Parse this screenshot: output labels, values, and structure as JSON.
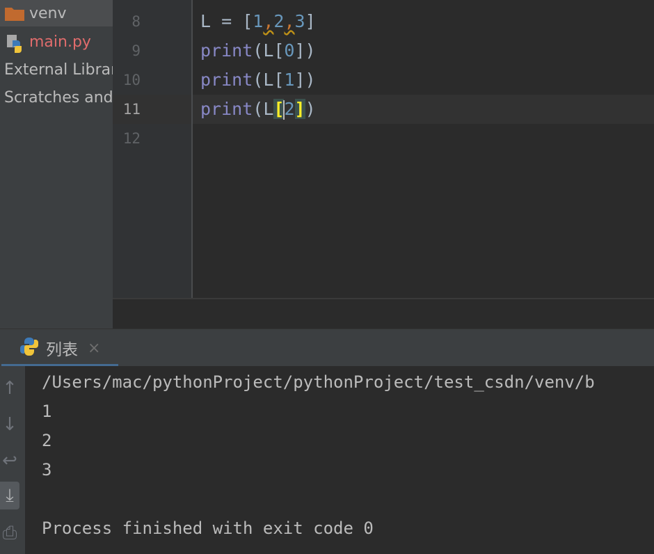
{
  "project_tree": {
    "items": [
      {
        "label": "venv",
        "icon": "folder-icon"
      },
      {
        "label": "main.py",
        "icon": "python-file-icon"
      },
      {
        "label": "External Libraries",
        "icon": ""
      },
      {
        "label": "Scratches and Consoles",
        "icon": ""
      }
    ]
  },
  "editor": {
    "line_numbers": [
      "8",
      "9",
      "10",
      "11",
      "12"
    ],
    "current_line": "11",
    "lines": {
      "l8_name": "L = [",
      "l8_n1": "1",
      "l8_c1": ",",
      "l8_n2": "2",
      "l8_c2": ",",
      "l8_n3": "3",
      "l8_close": "]",
      "l9_fn": "print",
      "l9_open": "(L[",
      "l9_num": "0",
      "l9_close": "])",
      "l10_fn": "print",
      "l10_open": "(L[",
      "l10_num": "1",
      "l10_close": "])",
      "l11_fn": "print",
      "l11_open": "(L",
      "l11_lb": "[",
      "l11_num": "2",
      "l11_rb": "]",
      "l11_close": ")"
    }
  },
  "run_panel": {
    "tab_label": "列表",
    "tab_close": "×",
    "console_lines": [
      "/Users/mac/pythonProject/pythonProject/test_csdn/venv/b",
      "1",
      "2",
      "3",
      "",
      "Process finished with exit code 0"
    ],
    "toolbar": {
      "up": "↑",
      "down": "↓",
      "wrap": "↩",
      "scroll_end": "⤓",
      "print": "⎙"
    }
  },
  "colors": {
    "keyword_fn": "#8888c6",
    "number": "#6897bb",
    "comma": "#cc7832",
    "modified_file": "#e06c6c"
  }
}
